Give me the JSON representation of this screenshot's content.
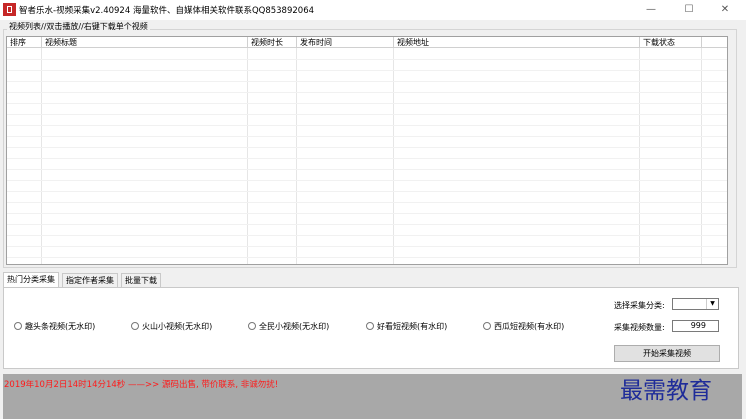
{
  "window": {
    "title": "智者乐水-视频采集v2.40924   海量软件、自媒体相关软件联系QQ853892064",
    "minimize": "—",
    "maximize": "☐",
    "close": "✕"
  },
  "list": {
    "legend": "视频列表//双击播放//右键下载单个视频",
    "columns": [
      "排序",
      "视频标题",
      "视频时长",
      "发布时间",
      "视频地址",
      "下载状态"
    ]
  },
  "tabs": [
    "热门分类采集",
    "指定作者采集",
    "批量下载"
  ],
  "sources": [
    "趣头条视频(无水印)",
    "火山小视频(无水印)",
    "全民小视频(无水印)",
    "好看短视频(有水印)",
    "西瓜短视频(有水印)"
  ],
  "options": {
    "category_label": "选择采集分类:",
    "category_value": "",
    "count_label": "采集视频数量:",
    "count_value": "999",
    "start_button": "开始采集视频"
  },
  "status": {
    "message": "2019年10月2日14时14分14秒 ——>> 源码出售, 带价联系, 非诚勿扰!"
  },
  "watermark": "最需教育"
}
